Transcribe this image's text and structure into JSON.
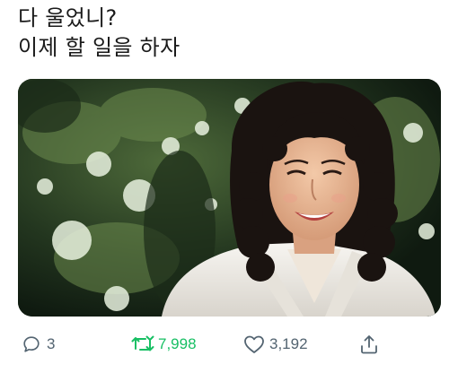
{
  "tweet": {
    "lines": [
      "다 울었니?",
      "이제 할 일을 하자"
    ]
  },
  "media": {
    "icon": "photo-of-smiling-woman-in-white-jacket"
  },
  "actions": {
    "reply": {
      "icon": "reply-bubble-icon",
      "count": "3"
    },
    "retweet": {
      "icon": "retweet-icon",
      "count": "7,998",
      "color": "#17bf63"
    },
    "like": {
      "icon": "heart-icon",
      "count": "3,192"
    },
    "share": {
      "icon": "share-icon"
    }
  },
  "colors": {
    "muted": "#536471",
    "retweet_active": "#17bf63",
    "text": "#1a1a1a"
  }
}
